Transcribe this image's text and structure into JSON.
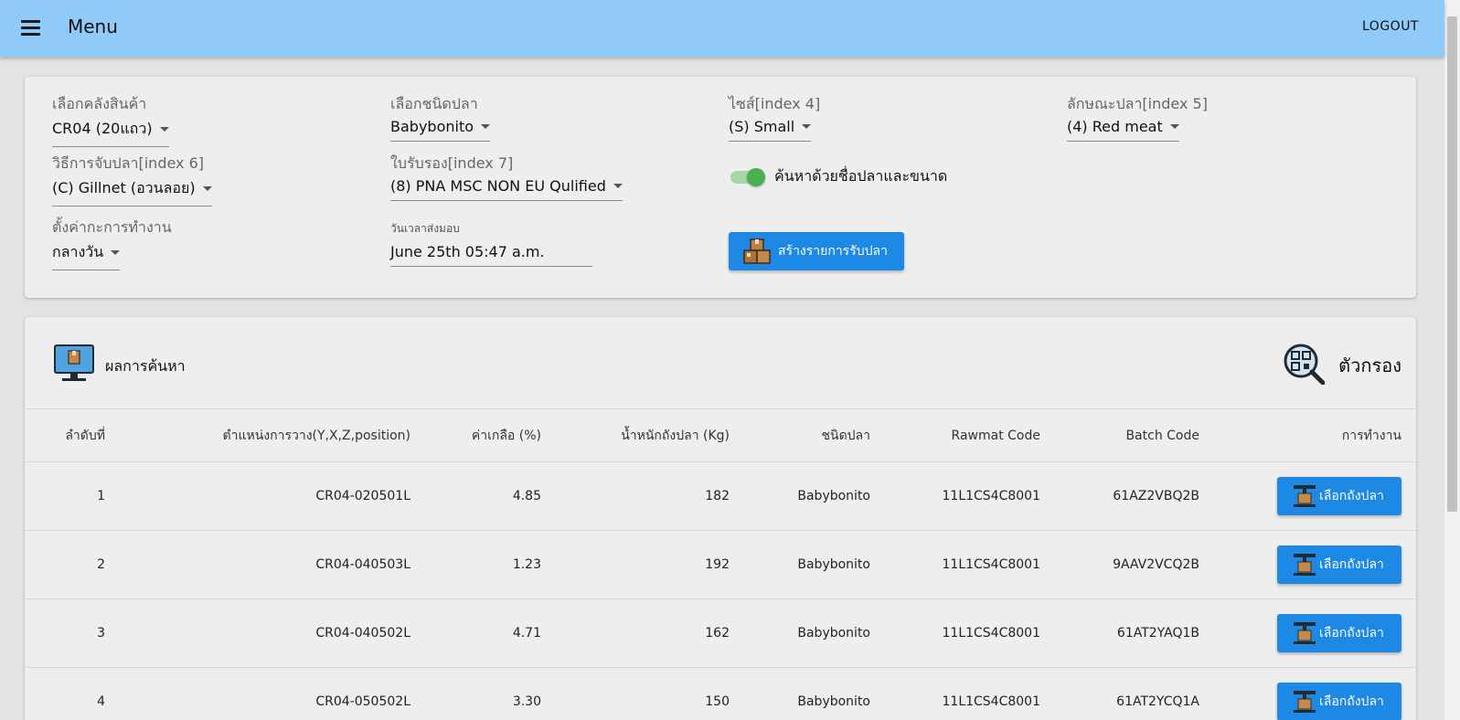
{
  "appbar": {
    "title": "Menu",
    "logout_label": "LOGOUT"
  },
  "form": {
    "warehouse": {
      "label": "เลือกคลังสินค้า",
      "value": "CR04 (20แถว)"
    },
    "fish_type": {
      "label": "เลือกชนิดปลา",
      "value": "Babybonito"
    },
    "size": {
      "label": "ไซส์[index 4]",
      "value": "(S) Small"
    },
    "fish_character": {
      "label": "ลักษณะปลา[index 5]",
      "value": "(4) Red meat"
    },
    "catch_method": {
      "label": "วิธีการจับปลา[index 6]",
      "value": "(C) Gillnet (อวนลอย)"
    },
    "certificate": {
      "label": "ใบรับรอง[index 7]",
      "value": "(8) PNA MSC NON EU Qulified"
    },
    "work_setting": {
      "label": "ตั้งค่ากะการทำงาน",
      "value": "กลางวัน"
    },
    "delivery_date": {
      "label": "วันเวลาส่งมอบ",
      "value": "June 25th 05:47 a.m."
    },
    "search_toggle": {
      "label": "ค้นหาด้วยชื่อปลาและขนาด",
      "checked": true
    },
    "create_button_label": "สร้างรายการรับปลา"
  },
  "results": {
    "title": "ผลการค้นหา",
    "filter_label": "ตัวกรอง",
    "columns": [
      "ลำดับที่",
      "ตำแหน่งการวาง(Y,X,Z,position)",
      "ค่าเกลือ (%)",
      "น้ำหนักถังปลา (Kg)",
      "ชนิดปลา",
      "Rawmat Code",
      "Batch Code",
      "การทำงาน"
    ],
    "rows": [
      {
        "no": "1",
        "position": "CR04-020501L",
        "salt": "4.85",
        "weight": "182",
        "fish": "Babybonito",
        "rawmat": "11L1CS4C8001",
        "batch": "61AZ2VBQ2B",
        "action": "เลือกถังปลา"
      },
      {
        "no": "2",
        "position": "CR04-040503L",
        "salt": "1.23",
        "weight": "192",
        "fish": "Babybonito",
        "rawmat": "11L1CS4C8001",
        "batch": "9AAV2VCQ2B",
        "action": "เลือกถังปลา"
      },
      {
        "no": "3",
        "position": "CR04-040502L",
        "salt": "4.71",
        "weight": "162",
        "fish": "Babybonito",
        "rawmat": "11L1CS4C8001",
        "batch": "61AT2YAQ1B",
        "action": "เลือกถังปลา"
      },
      {
        "no": "4",
        "position": "CR04-050502L",
        "salt": "3.30",
        "weight": "150",
        "fish": "Babybonito",
        "rawmat": "11L1CS4C8001",
        "batch": "61AT2YCQ1A",
        "action": "เลือกถังปลา"
      }
    ]
  },
  "colors": {
    "appbar": "#90caf9",
    "primary_button": "#1e88e5",
    "toggle_on": "#4caf50"
  },
  "icons": {
    "menu": "hamburger-icon",
    "create": "boxes-icon",
    "monitor": "monitor-box-icon",
    "filter": "magnifier-qr-icon",
    "pick": "crate-lift-icon"
  }
}
